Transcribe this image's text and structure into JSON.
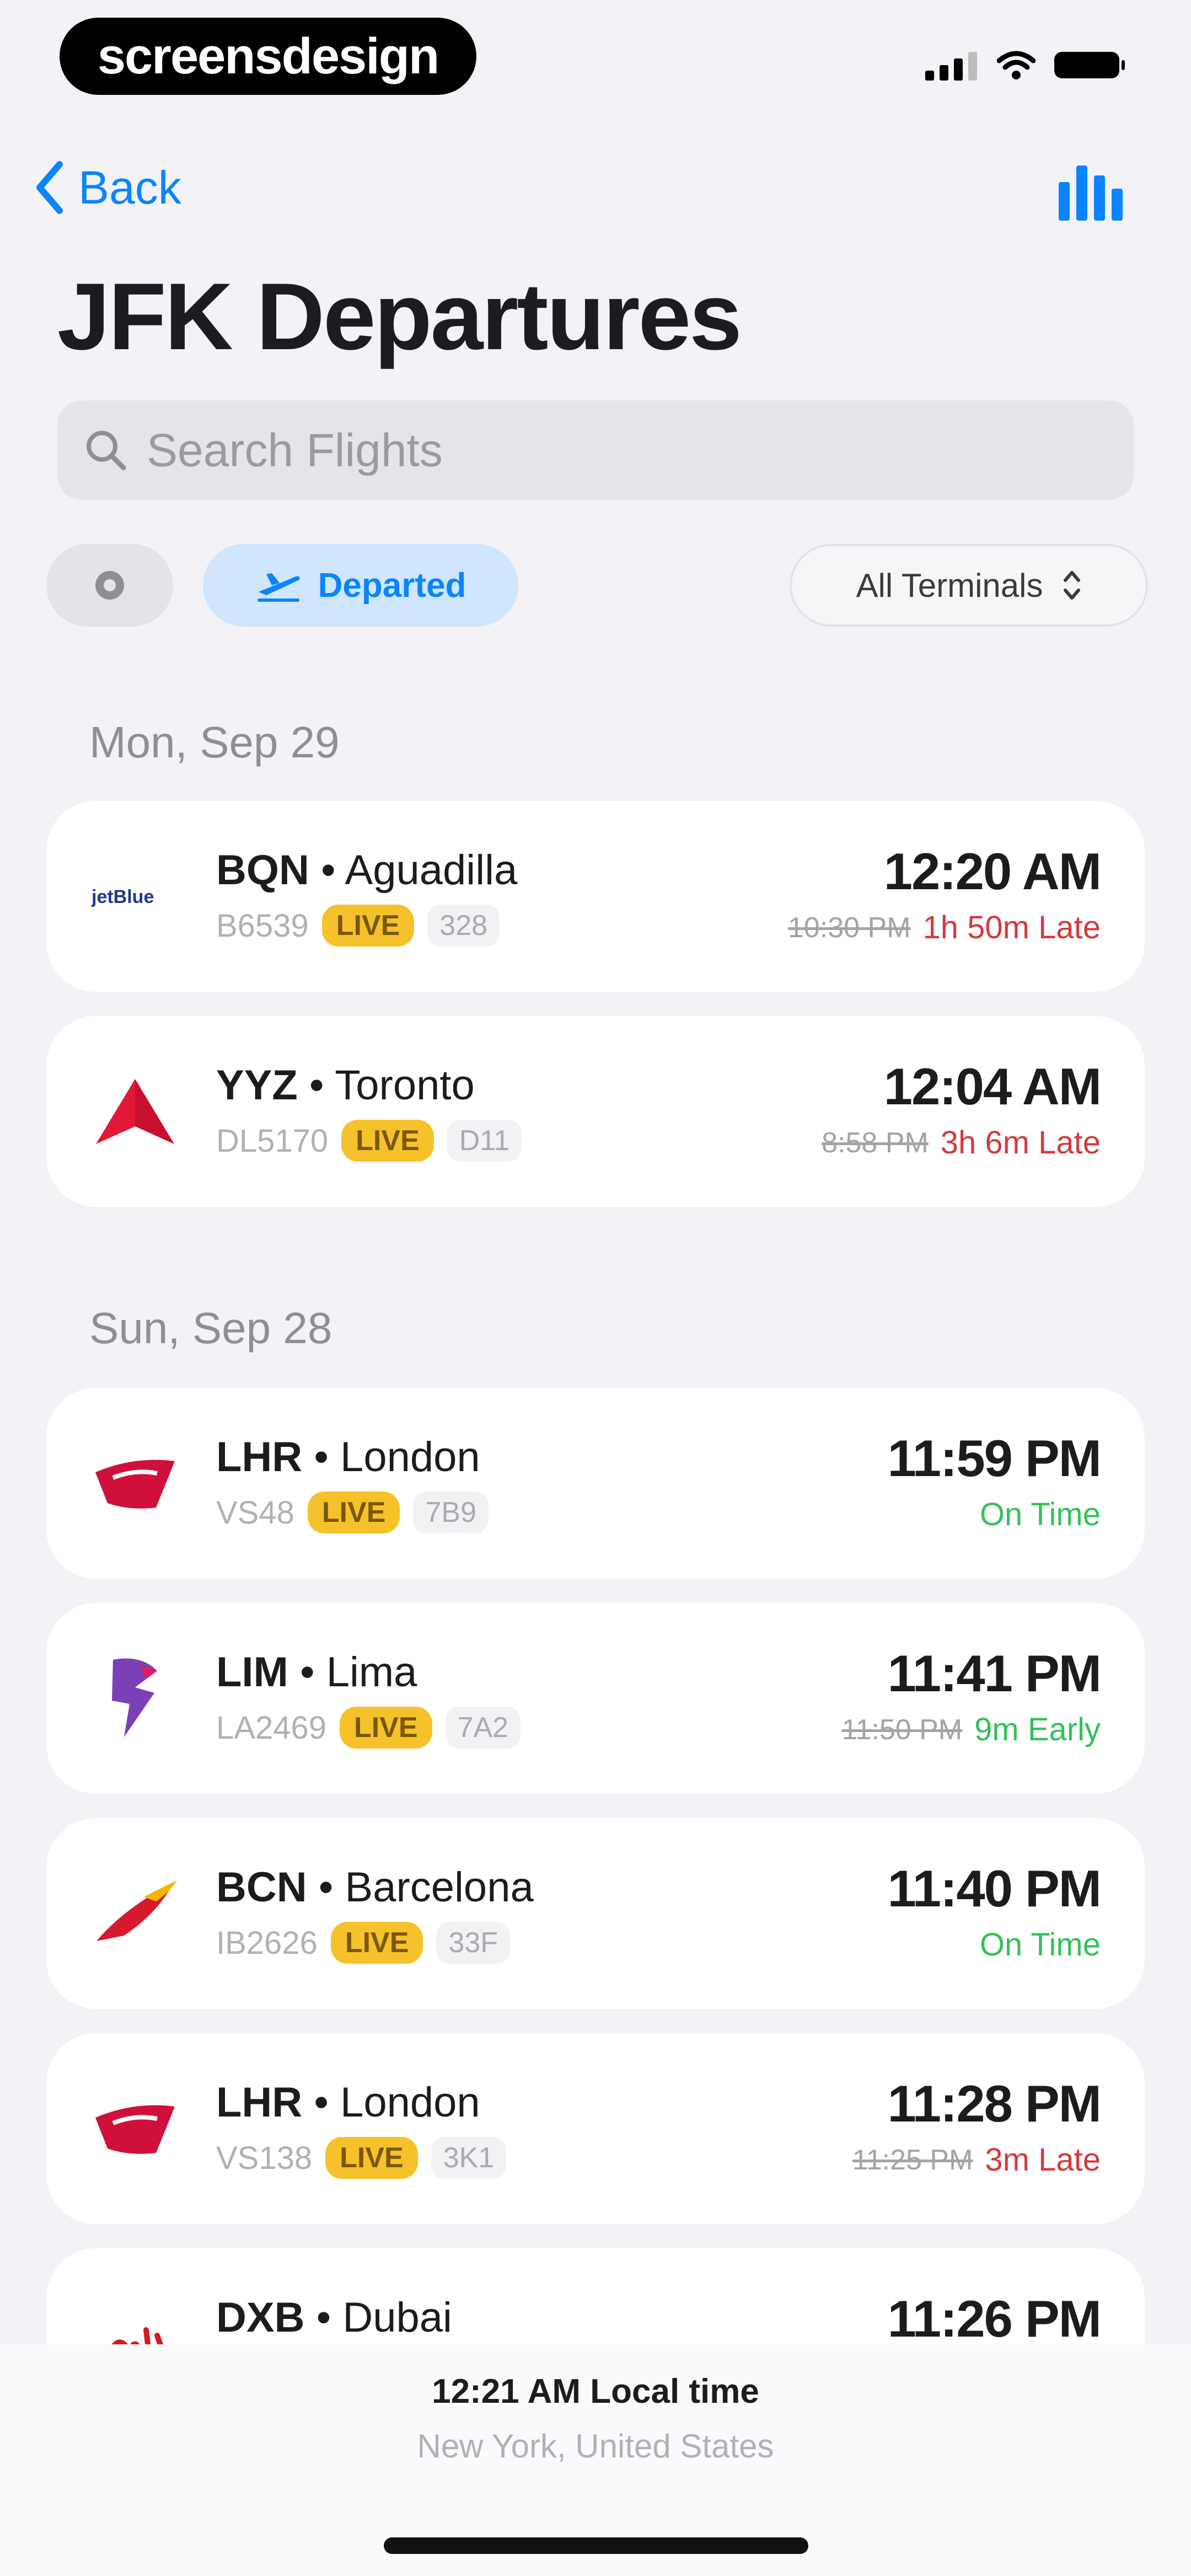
{
  "status_bar": {
    "logo_text": "screensdesign"
  },
  "nav": {
    "back_label": "Back",
    "chart_icon": "bar-chart-icon"
  },
  "page": {
    "title": "JFK Departures"
  },
  "search": {
    "placeholder": "Search Flights"
  },
  "filters": {
    "departed_label": "Departed",
    "terminal_label": "All Terminals"
  },
  "sections": [
    {
      "date": "Mon, Sep 29",
      "flights": [
        {
          "code": "BQN",
          "city": "Aguadilla",
          "flight": "B6539",
          "badge": "LIVE",
          "gate": "328",
          "time": "12:20 AM",
          "scheduled": "10:30 PM",
          "status": "1h 50m Late",
          "status_type": "late",
          "airline_logo": "jetblue-logo"
        },
        {
          "code": "YYZ",
          "city": "Toronto",
          "flight": "DL5170",
          "badge": "LIVE",
          "gate": "D11",
          "time": "12:04 AM",
          "scheduled": "8:58 PM",
          "status": "3h 6m Late",
          "status_type": "late",
          "airline_logo": "delta-logo"
        }
      ]
    },
    {
      "date": "Sun, Sep 28",
      "flights": [
        {
          "code": "LHR",
          "city": "London",
          "flight": "VS48",
          "badge": "LIVE",
          "gate": "7B9",
          "time": "11:59 PM",
          "scheduled": "",
          "status": "On Time",
          "status_type": "ok",
          "airline_logo": "virgin-logo"
        },
        {
          "code": "LIM",
          "city": "Lima",
          "flight": "LA2469",
          "badge": "LIVE",
          "gate": "7A2",
          "time": "11:41 PM",
          "scheduled": "11:50 PM",
          "status": "9m Early",
          "status_type": "ok",
          "airline_logo": "latam-logo"
        },
        {
          "code": "BCN",
          "city": "Barcelona",
          "flight": "IB2626",
          "badge": "LIVE",
          "gate": "33F",
          "time": "11:40 PM",
          "scheduled": "",
          "status": "On Time",
          "status_type": "ok",
          "airline_logo": "iberia-logo"
        },
        {
          "code": "LHR",
          "city": "London",
          "flight": "VS138",
          "badge": "LIVE",
          "gate": "3K1",
          "time": "11:28 PM",
          "scheduled": "11:25 PM",
          "status": "3m Late",
          "status_type": "late",
          "airline_logo": "virgin-logo"
        },
        {
          "code": "DXB",
          "city": "Dubai",
          "flight": "",
          "badge": "",
          "gate": "",
          "time": "11:26 PM",
          "scheduled": "",
          "status": "",
          "status_type": "",
          "airline_logo": "emirates-logo"
        }
      ]
    }
  ],
  "footer": {
    "local_time": "12:21 AM Local time",
    "location": "New York, United States"
  },
  "colors": {
    "accent": "#0A84FF",
    "late": "#D33A3F",
    "on_time": "#36C05C",
    "live": "#F6C22B"
  }
}
